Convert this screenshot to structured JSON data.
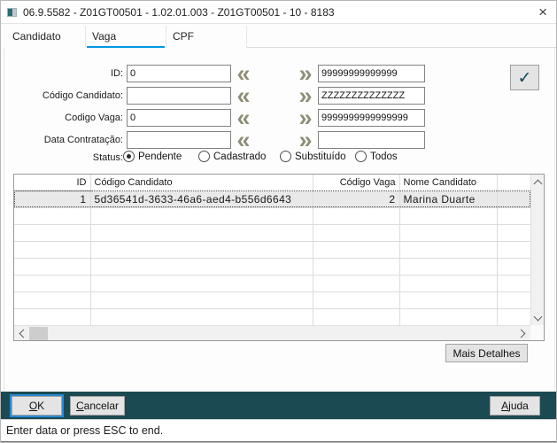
{
  "window": {
    "title": "06.9.5582 - Z01GT00501 - 1.02.01.003 - Z01GT00501 - 10 - 8183",
    "close_icon": "×"
  },
  "tabs": [
    {
      "label": "Candidato",
      "selected": false
    },
    {
      "label": "Vaga",
      "selected": true
    },
    {
      "label": "CPF",
      "selected": false
    }
  ],
  "form": {
    "rows": [
      {
        "label": "ID:",
        "left_value": "0",
        "right_value": "99999999999999"
      },
      {
        "label": "Código Candidato:",
        "left_value": "",
        "right_value": "ZZZZZZZZZZZZZZ"
      },
      {
        "label": "Codigo Vaga:",
        "left_value": "0",
        "right_value": "9999999999999999"
      },
      {
        "label": "Data Contratação:",
        "left_value": "",
        "right_value": ""
      }
    ],
    "range_from_icon": "«",
    "range_to_icon": "»",
    "confirm_icon": "✓"
  },
  "status_filter": {
    "label": "Status:",
    "options": [
      {
        "label": "Pendente",
        "selected": true
      },
      {
        "label": "Cadastrado",
        "selected": false
      },
      {
        "label": "Substituído",
        "selected": false
      },
      {
        "label": "Todos",
        "selected": false
      }
    ]
  },
  "table": {
    "columns": [
      {
        "label": "ID"
      },
      {
        "label": "Código Candidato"
      },
      {
        "label": "Código Vaga"
      },
      {
        "label": "Nome Candidato"
      },
      {
        "label": ""
      }
    ],
    "rows": [
      {
        "id": "1",
        "codigo_candidato": "5d36541d-3633-46a6-aed4-b556d6643",
        "codigo_vaga": "2",
        "nome_candidato": "Marina Duarte"
      }
    ],
    "empty_row_count": 8
  },
  "buttons": {
    "mais_detalhes": "Mais Detalhes",
    "ok_initial": "O",
    "ok_rest": "K",
    "cancelar_initial": "C",
    "cancelar_rest": "ancelar",
    "ajuda_initial": "A",
    "ajuda_rest": "juda"
  },
  "status_bar": {
    "message": "Enter data or press ESC to end."
  },
  "colors": {
    "accent_blue": "#0098e0",
    "panel_teal": "#1c4a52",
    "chevron": "#8f8f78",
    "check": "#16465a",
    "selected_row": "#e9e9e9"
  }
}
